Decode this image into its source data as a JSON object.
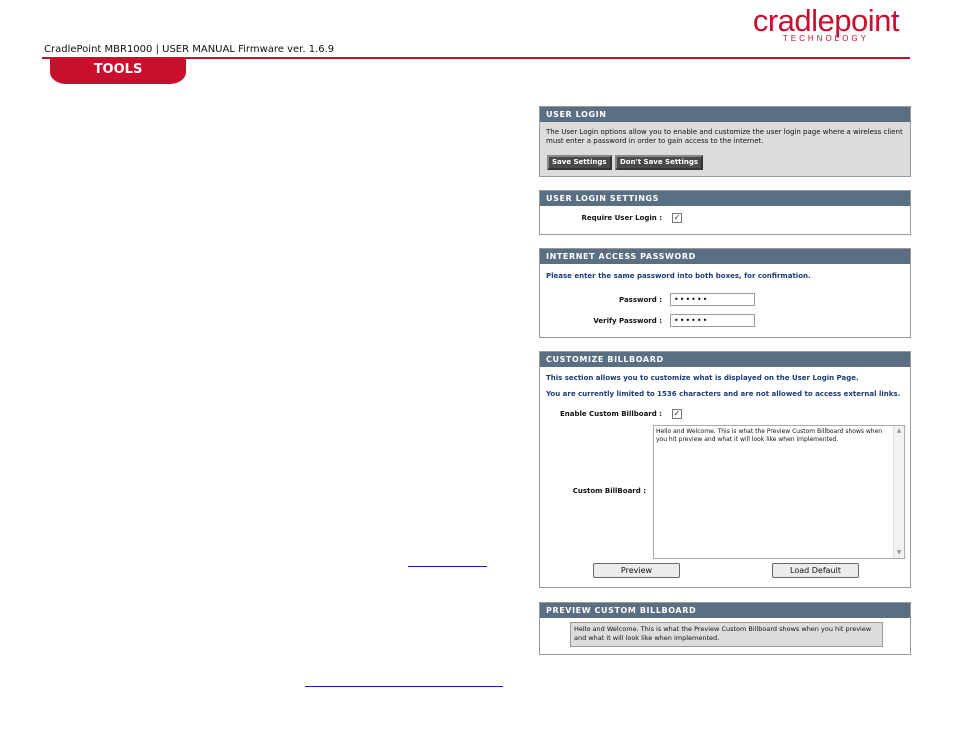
{
  "header": {
    "doc_title": "CradlePoint MBR1000 | USER MANUAL Firmware ver. 1.6.9",
    "logo_word": "cradlepoint",
    "logo_sub": "TECHNOLOGY",
    "section_tab": "TOOLS"
  },
  "user_login": {
    "title": "USER LOGIN",
    "description": "The User Login options allow you to enable and customize the user login page where a wireless client must enter a password in order to gain access to the internet.",
    "save_label": "Save Settings",
    "dont_save_label": "Don't Save Settings"
  },
  "user_login_settings": {
    "title": "USER LOGIN SETTINGS",
    "require_label": "Require User Login :",
    "require_checked": true
  },
  "internet_access_password": {
    "title": "INTERNET ACCESS PASSWORD",
    "instruction": "Please enter the same password into both boxes, for confirmation.",
    "password_label": "Password :",
    "password_value": "••••••",
    "verify_label": "Verify Password :",
    "verify_value": "••••••"
  },
  "customize_billboard": {
    "title": "CUSTOMIZE BILLBOARD",
    "line1": "This section allows you to customize what is displayed on the User Login Page.",
    "line2": "You are currently limited to 1536 characters and are not allowed to access external links.",
    "enable_label": "Enable Custom Billboard :",
    "enable_checked": true,
    "billboard_label": "Custom BillBoard :",
    "billboard_text": "Hello and Welcome.  This is what the Preview Custom Billboard shows when you hit preview and what it will look like when implemented.",
    "preview_label": "Preview",
    "load_default_label": "Load Default"
  },
  "preview_billboard": {
    "title": "PREVIEW CUSTOM BILLBOARD",
    "text": "Hello and Welcome. This is what the Preview Custom Billboard shows when you hit preview and what it will look like when implemented."
  },
  "colors": {
    "brand_red": "#c8102e",
    "panel_header": "#5a6e84",
    "accent_blue": "#1a3b78"
  }
}
